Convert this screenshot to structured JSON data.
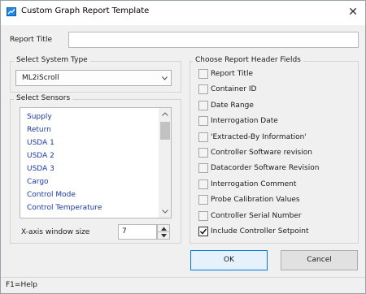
{
  "window": {
    "title": "Custom Graph Report Template",
    "close_glyph": "✕"
  },
  "report_title": {
    "label": "Report Title",
    "value": ""
  },
  "system_type": {
    "group_label": "Select System Type",
    "selected": "ML2iScroll"
  },
  "sensors": {
    "group_label": "Select Sensors",
    "items": [
      "Supply",
      "Return",
      "USDA 1",
      "USDA 2",
      "USDA 3",
      "Cargo",
      "Control Mode",
      "Control Temperature"
    ],
    "xaxis_label": "X-axis window size",
    "xaxis_value": "7"
  },
  "header_fields": {
    "group_label": "Choose Report Header Fields",
    "items": [
      {
        "label": "Report Title",
        "checked": false
      },
      {
        "label": "Container ID",
        "checked": false
      },
      {
        "label": "Date Range",
        "checked": false
      },
      {
        "label": "Interrogation Date",
        "checked": false
      },
      {
        "label": "'Extracted-By Information'",
        "checked": false
      },
      {
        "label": "Controller Software revision",
        "checked": false
      },
      {
        "label": "Datacorder Software Revision",
        "checked": false
      },
      {
        "label": "Interrogation Comment",
        "checked": false
      },
      {
        "label": "Probe Calibration Values",
        "checked": false
      },
      {
        "label": "Controller Serial Number",
        "checked": false
      },
      {
        "label": "Include Controller Setpoint",
        "checked": true
      }
    ]
  },
  "buttons": {
    "ok": "OK",
    "cancel": "Cancel"
  },
  "status": {
    "help": "F1=Help"
  },
  "colors": {
    "accent": "#0078d7",
    "list_text": "#1a3aa7",
    "app_icon": "#1e88e5"
  }
}
